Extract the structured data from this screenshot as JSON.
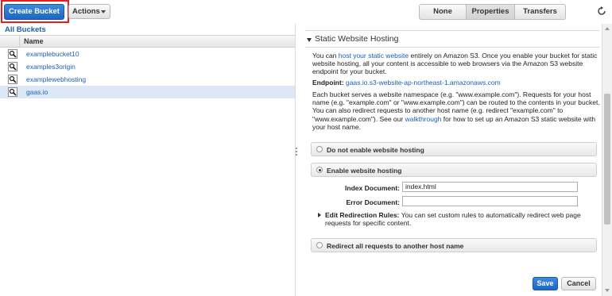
{
  "toolbar": {
    "create_bucket": "Create Bucket",
    "actions": "Actions",
    "view_tabs": [
      "None",
      "Properties",
      "Transfers"
    ],
    "active_view": "Properties",
    "refresh_icon": "refresh-icon"
  },
  "left": {
    "breadcrumb": "All Buckets",
    "column_name": "Name",
    "buckets": [
      {
        "name": "examplebucket10",
        "selected": false
      },
      {
        "name": "examples3origin",
        "selected": false
      },
      {
        "name": "examplewebhosting",
        "selected": false
      },
      {
        "name": "gaas.io",
        "selected": true
      }
    ]
  },
  "section": {
    "title": "Static Website Hosting",
    "intro_prefix": "You can ",
    "intro_link": "host your static website",
    "intro_suffix": " entirely on Amazon S3. Once you enable your bucket for static website hosting, all your content is accessible to web browsers via the Amazon S3 website endpoint for your bucket.",
    "endpoint_label": "Endpoint:",
    "endpoint_value": "gaas.io.s3-website-ap-northeast-1.amazonaws.com",
    "info_prefix": "Each bucket serves a website namespace (e.g. \"www.example.com\"). Requests for your host name (e.g. \"example.com\" or \"www.example.com\") can be routed to the contents in your bucket. You can also redirect requests to another host name (e.g. redirect \"example.com\" to \"www.example.com\"). See our ",
    "info_link": "walkthrough",
    "info_suffix": " for how to set up an Amazon S3 static website with your host name."
  },
  "options": {
    "disable": "Do not enable website hosting",
    "enable": "Enable website hosting",
    "redirect": "Redirect all requests to another host name",
    "selected": "enable"
  },
  "form": {
    "index_label": "Index Document:",
    "index_value": "index.html",
    "error_label": "Error Document:",
    "error_value": "",
    "redirection_label": "Edit Redirection Rules:",
    "redirection_text": " You can set custom rules to automatically redirect web page requests for specific content."
  },
  "footer": {
    "save": "Save",
    "cancel": "Cancel"
  },
  "colors": {
    "accent": "#1e66c4",
    "link": "#1a5fb4",
    "highlight": "#e41f1f",
    "selected_row": "#dde8f6"
  }
}
